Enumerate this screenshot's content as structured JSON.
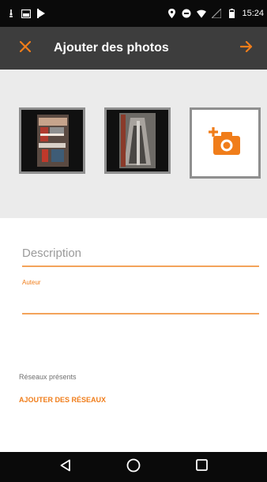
{
  "status_bar": {
    "time": "15:24",
    "icons": [
      "notification-icon",
      "image-notification-icon",
      "play-store-icon",
      "location-icon",
      "data-saver-icon",
      "wifi-icon",
      "signal-icon",
      "battery-icon"
    ]
  },
  "toolbar": {
    "title": "Ajouter des photos",
    "close_icon": "close-icon",
    "next_icon": "arrow-right-icon"
  },
  "photos": {
    "count": 2,
    "add_icon": "add-photo-camera-icon"
  },
  "form": {
    "description_placeholder": "Description",
    "author_label": "Auteur",
    "author_value": ""
  },
  "networks": {
    "label": "Réseaux présents",
    "add_action": "AJOUTER DES RÉSEAUX"
  },
  "nav_bar": {
    "icons": [
      "back-icon",
      "home-icon",
      "recents-icon"
    ]
  },
  "colors": {
    "accent": "#f07d1a",
    "toolbar_bg": "#3d3d3d",
    "status_bg": "#0a0a0a",
    "photos_bg": "#ebebeb"
  }
}
